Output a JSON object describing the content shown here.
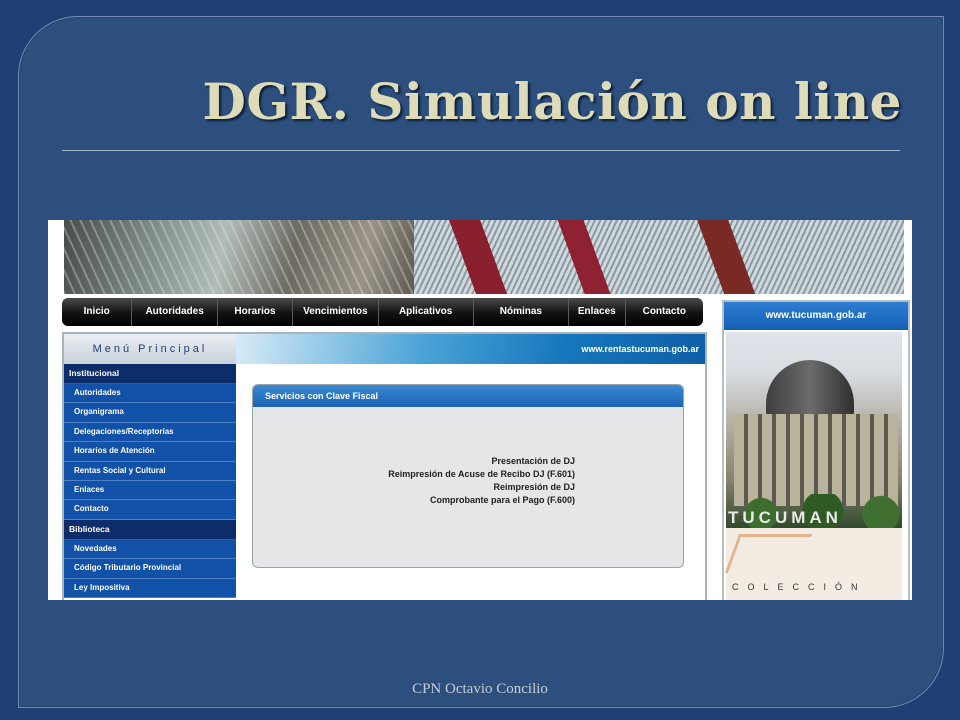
{
  "slide": {
    "title": "DGR. Simulación on line",
    "footer": "CPN Octavio Concilio"
  },
  "site": {
    "nav": [
      "Inicio",
      "Autoridades",
      "Horarios",
      "Vencimientos",
      "Aplicativos",
      "Nóminas",
      "Enlaces",
      "Contacto"
    ],
    "menu_title": "Menú Principal",
    "url": "www.rentastucuman.gob.ar",
    "sections": [
      {
        "title": "Institucional",
        "items": [
          "Autoridades",
          "Organigrama",
          "Delegaciones/Receptorías",
          "Horarios de Atención",
          "Rentas Social y Cultural",
          "Enlaces",
          "Contacto"
        ]
      },
      {
        "title": "Biblioteca",
        "items": [
          "Novedades",
          "Código Tributario Provincial",
          "Ley Impositiva"
        ]
      }
    ],
    "content_title": "Servicios con Clave Fiscal",
    "links": [
      "Presentación de DJ",
      "Reimpresión de Acuse de Recibo DJ (F.601)",
      "Reimpresión de DJ",
      "Comprobante para el Pago (F.600)"
    ],
    "side_url": "www.tucuman.gob.ar",
    "side_caption": "TUCUMAN",
    "side_collection": "COLECCIÓN"
  }
}
